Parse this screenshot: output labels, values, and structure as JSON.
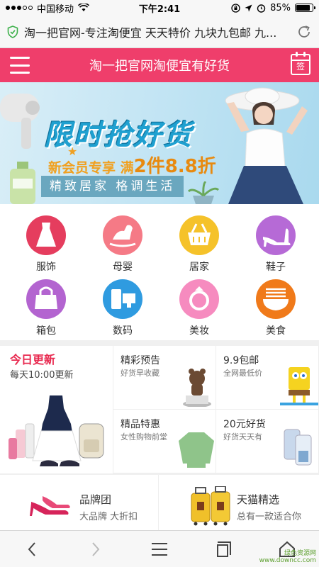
{
  "status_bar": {
    "carrier": "中国移动",
    "time": "下午2:41",
    "battery_percent": "85%",
    "battery_level": 0.85,
    "wifi_icon": "wifi-icon",
    "location_icon": "location-arrow-icon",
    "alarm_icon": "alarm-icon",
    "lock_icon": "rotation-lock-icon"
  },
  "url_bar": {
    "text": "淘一把官网-专注淘便宜 天天特价 九块九包邮 九...",
    "shield_icon": "shield-icon",
    "reload_icon": "reload-icon"
  },
  "header": {
    "title": "淘一把官网淘便宜有好货",
    "menu_icon": "menu-icon",
    "signin_label": "签",
    "brand_color": "#ef3e6b"
  },
  "banner": {
    "title": "限时抢好货",
    "sub_prefix": "新会员专享 满",
    "sub_big": "2件8.8折",
    "slogan": "精致居家  格调生活"
  },
  "categories": [
    {
      "label": "服饰",
      "color": "#e53d5e",
      "icon": "dress-icon"
    },
    {
      "label": "母婴",
      "color": "#f57a86",
      "icon": "rocking-horse-icon"
    },
    {
      "label": "居家",
      "color": "#f5c22a",
      "icon": "basket-icon"
    },
    {
      "label": "鞋子",
      "color": "#b66ad6",
      "icon": "high-heel-icon"
    },
    {
      "label": "箱包",
      "color": "#b364d0",
      "icon": "handbag-icon"
    },
    {
      "label": "数码",
      "color": "#2f9be0",
      "icon": "devices-icon"
    },
    {
      "label": "美妆",
      "color": "#f68bbf",
      "icon": "ring-icon"
    },
    {
      "label": "美食",
      "color": "#f07a1a",
      "icon": "noodle-bowl-icon"
    }
  ],
  "today": {
    "title": "今日更新",
    "subtitle": "每天10:00更新"
  },
  "promos": [
    {
      "title": "精彩预告",
      "subtitle": "好货早收藏",
      "icon": "bear-figure-icon"
    },
    {
      "title": "9.9包邮",
      "subtitle": "全网最低价",
      "icon": "sponge-toy-icon"
    },
    {
      "title": "精品特惠",
      "subtitle": "女性购物前堂",
      "icon": "sweater-icon"
    },
    {
      "title": "20元好货",
      "subtitle": "好货天天有",
      "icon": "phone-case-icon"
    }
  ],
  "brands": [
    {
      "title": "品牌团",
      "subtitle": "大品牌 大折扣",
      "icon": "pink-heels-icon"
    },
    {
      "title": "天猫精选",
      "subtitle": "总有一款适合你",
      "icon": "suitcase-icon"
    }
  ],
  "toolbar": {
    "back_icon": "back-arrow-icon",
    "forward_icon": "forward-arrow-icon",
    "menu_icon": "hamburger-icon",
    "tabs_icon": "tabs-icon",
    "home_icon": "home-icon"
  },
  "watermark": {
    "line1": "绿色资源网",
    "line2": "www.downcc.com"
  }
}
